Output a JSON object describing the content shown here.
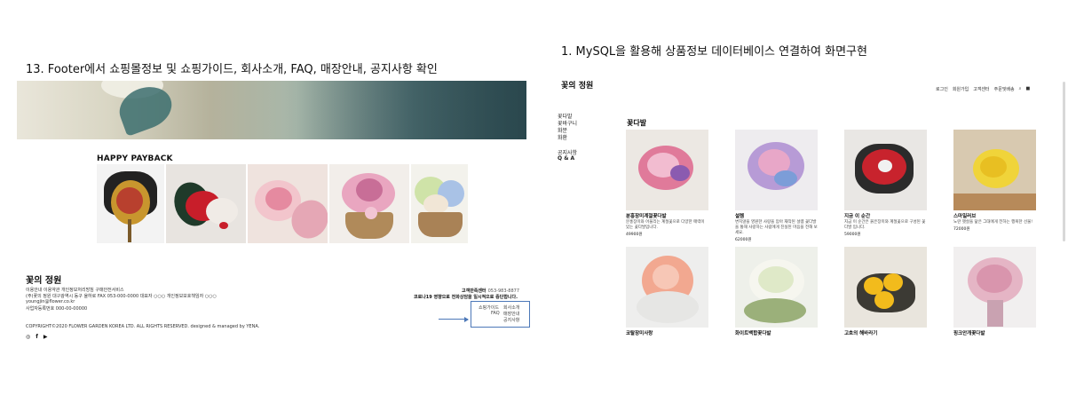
{
  "captions": {
    "left": "13. Footer에서 쇼핑몰정보 및 쇼핑가이드, 회사소개, FAQ, 매장안내, 공지사항 확인",
    "right": "1. MySQL을 활용해 상품정보 데이터베이스 연결하여 화면구현"
  },
  "left_panel": {
    "banner_alt": "banner",
    "happy_payback_title": "HAPPY PAYBACK",
    "payback_images": [
      "wreath",
      "red-rose-bouquet",
      "pink-rose-bouquet",
      "pink-basket",
      "hydrangea-basket"
    ],
    "footer": {
      "logo": "꽃의 정원",
      "line1": "이용안내 이용약관 개인정보처리방침 구매안전서비스",
      "line2": "(주)꽃의 정원 대구광역시 동구 율하로 FAX 053-000-0000 대표자 ○○○ 개인정보보호책임자 ○○○",
      "line3": "youngjin@flower.co.kr",
      "line4": "사업자등록번호 000-00-00000",
      "cs_title": "고객만족센터",
      "cs_phone": "053-983-8877",
      "corona_notice": "코로나19 영향으로 전화상담을 일시적으로 중단합니다.",
      "links": {
        "shopping_guide": "쇼핑가이드",
        "about": "회사소개",
        "faq": "FAQ",
        "store_info": "매장안내",
        "notice": "공지사항"
      },
      "copyright": "COPYRIGHT©2020 FLOWER GARDEN KOREA LTD. ALL RIGHTS RESERVED. designed & managed by YENA.",
      "sns": [
        "instagram-icon",
        "facebook-icon",
        "youtube-icon"
      ]
    }
  },
  "right_panel": {
    "logo": "꽃의 정원",
    "topnav": [
      "로그인",
      "회원가입",
      "고객센터",
      "주문및배송"
    ],
    "sidebar_group1": [
      "꽃다발",
      "꽃바구니",
      "화분",
      "화환"
    ],
    "sidebar_group2": [
      "공지사항",
      "Q & A"
    ],
    "section_title": "꽃다발",
    "products_row1": [
      {
        "name": "분홍장미계절꽃다발",
        "desc": "분홍장미와 어울리는 계절꽃으로 다양한 매력이 있는 꽃다발입니다.",
        "price": "49900원"
      },
      {
        "name": "설렘",
        "desc": "변치않을 영원한 사랑을 맘아 재작된 설렘 꽃다발을 통해 사랑하는 사람에게 진실된 마음을 전해 보세요.",
        "price": "62000원"
      },
      {
        "name": "지금 이 순간",
        "desc": "지금 이 순간은 붉은장미와 계절꽃으로 구성된 꽃다발 입니다.",
        "price": "59000원"
      },
      {
        "name": "스마일러브",
        "desc": "노란 햇살을 닮은 그대에게 전하는 행복한 선물!",
        "price": "72000원"
      }
    ],
    "products_row2": [
      {
        "name": "코랄장미사랑"
      },
      {
        "name": "화이트백합꽃다발"
      },
      {
        "name": "고흐의 해바라기"
      },
      {
        "name": "핑크안개꽃다발"
      }
    ]
  }
}
